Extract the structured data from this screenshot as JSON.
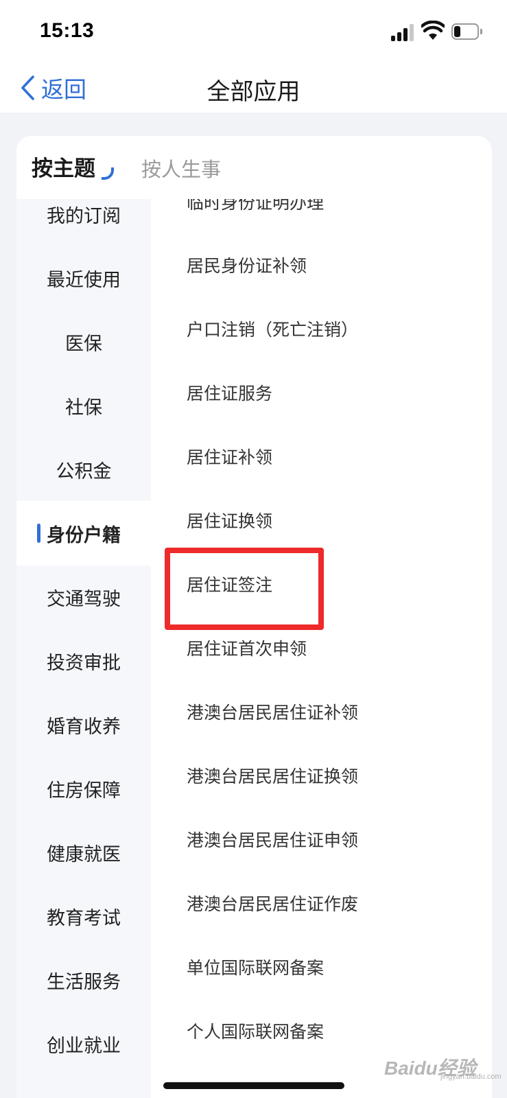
{
  "status_bar": {
    "time": "15:13"
  },
  "nav": {
    "back_label": "返回",
    "title": "全部应用"
  },
  "tabs": {
    "active": "按主题",
    "inactive": "按人生事"
  },
  "sidebar": {
    "items": [
      {
        "label": "我的订阅"
      },
      {
        "label": "最近使用"
      },
      {
        "label": "医保"
      },
      {
        "label": "社保"
      },
      {
        "label": "公积金"
      },
      {
        "label": "身份户籍",
        "active": true
      },
      {
        "label": "交通驾驶"
      },
      {
        "label": "投资审批"
      },
      {
        "label": "婚育收养"
      },
      {
        "label": "住房保障"
      },
      {
        "label": "健康就医"
      },
      {
        "label": "教育考试"
      },
      {
        "label": "生活服务"
      },
      {
        "label": "创业就业"
      }
    ]
  },
  "services": [
    "临时身份证明办理",
    "居民身份证补领",
    "户口注销（死亡注销）",
    "居住证服务",
    "居住证补领",
    "居住证换领",
    "居住证签注",
    "居住证首次申领",
    "港澳台居民居住证补领",
    "港澳台居民居住证换领",
    "港澳台居民居住证申领",
    "港澳台居民居住证作废",
    "单位国际联网备案",
    "个人国际联网备案"
  ],
  "watermark": {
    "text": "Baidu经验",
    "sub": "jingyan.baidu.com"
  },
  "colors": {
    "accent": "#2f6fd6",
    "highlight": "#ee2a2a",
    "sidebar_bg": "#f5f7fb"
  }
}
